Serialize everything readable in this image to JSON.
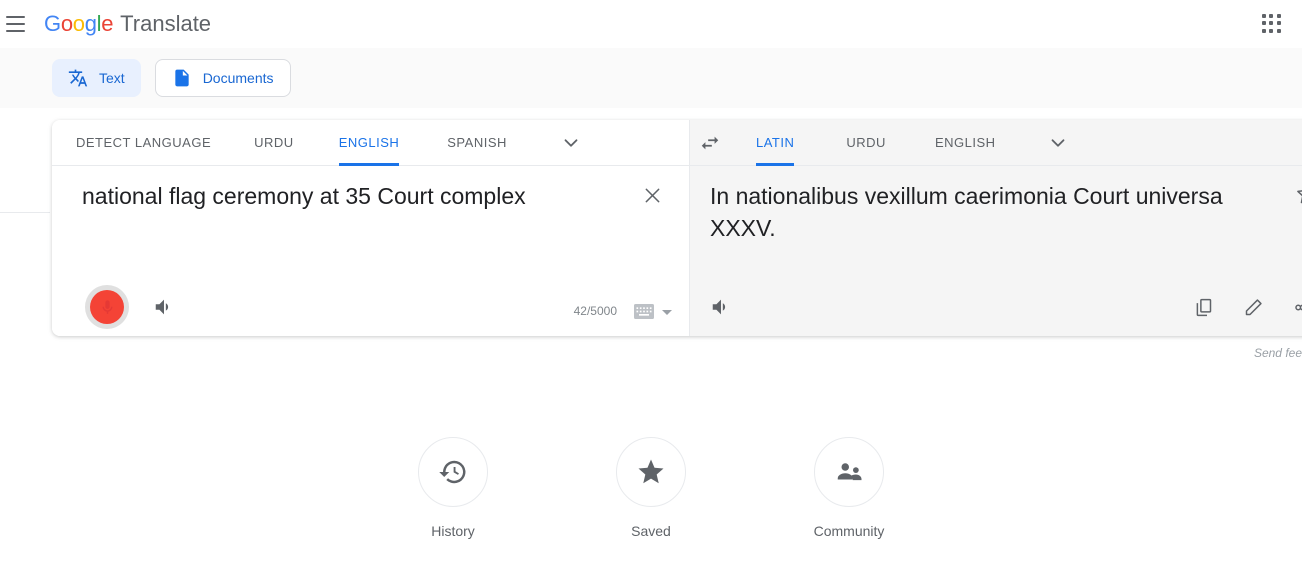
{
  "header": {
    "menu_icon": "hamburger-menu-icon",
    "logo_letters": [
      "G",
      "o",
      "o",
      "g",
      "l",
      "e"
    ],
    "product_name": "Translate",
    "apps_icon": "google-apps-grid-icon"
  },
  "mode_tabs": [
    {
      "id": "text",
      "label": "Text",
      "icon": "translate-icon",
      "active": true
    },
    {
      "id": "documents",
      "label": "Documents",
      "icon": "document-icon",
      "active": false
    }
  ],
  "source": {
    "languages": [
      {
        "label": "DETECT LANGUAGE",
        "active": false
      },
      {
        "label": "URDU",
        "active": false
      },
      {
        "label": "ENGLISH",
        "active": true
      },
      {
        "label": "SPANISH",
        "active": false
      }
    ],
    "more_icon": "chevron-down-icon",
    "text": "national flag ceremony at 35 Court complex",
    "clear_icon": "close-icon",
    "mic_icon": "microphone-icon",
    "mic_recording": true,
    "speaker_icon": "speaker-icon",
    "char_count": "42/5000",
    "keyboard_icon": "keyboard-icon",
    "keyboard_caret_icon": "caret-down-icon"
  },
  "swap": {
    "icon": "swap-languages-icon"
  },
  "target": {
    "languages": [
      {
        "label": "LATIN",
        "active": true
      },
      {
        "label": "URDU",
        "active": false
      },
      {
        "label": "ENGLISH",
        "active": false
      }
    ],
    "more_icon": "chevron-down-icon",
    "text": "In nationalibus vexillum caerimonia Court universa XXXV.",
    "star_icon": "star-outline-icon",
    "speaker_icon": "speaker-icon",
    "copy_icon": "copy-icon",
    "edit_icon": "pencil-edit-icon",
    "share_icon": "share-icon"
  },
  "feedback": {
    "text": "Send fee"
  },
  "shortcuts": [
    {
      "id": "history",
      "label": "History",
      "icon": "history-clock-icon"
    },
    {
      "id": "saved",
      "label": "Saved",
      "icon": "star-filled-icon"
    },
    {
      "id": "community",
      "label": "Community",
      "icon": "people-community-icon"
    }
  ],
  "colors": {
    "accent_blue": "#1a73e8",
    "chip_blue_bg": "#e8f0fe",
    "chip_blue_text": "#1967d2",
    "mic_red": "#f44336",
    "text_primary": "#202124",
    "text_secondary": "#5f6368",
    "panel_gray": "#f5f5f5"
  }
}
